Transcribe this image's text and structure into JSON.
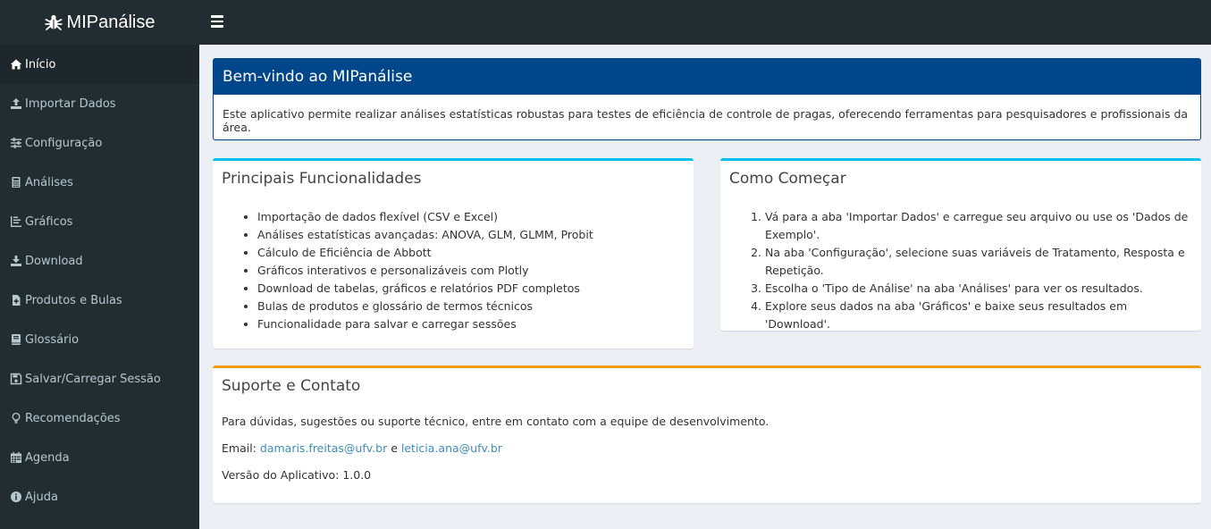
{
  "app": {
    "title": "MIPanálise"
  },
  "sidebar": {
    "items": [
      {
        "label": "Início",
        "icon": "home-icon"
      },
      {
        "label": "Importar Dados",
        "icon": "upload-icon"
      },
      {
        "label": "Configuração",
        "icon": "sliders-icon"
      },
      {
        "label": "Análises",
        "icon": "calculator-icon"
      },
      {
        "label": "Gráficos",
        "icon": "chart-icon"
      },
      {
        "label": "Download",
        "icon": "download-icon"
      },
      {
        "label": "Produtos e Bulas",
        "icon": "file-medical-icon"
      },
      {
        "label": "Glossário",
        "icon": "book-icon"
      },
      {
        "label": "Salvar/Carregar Sessão",
        "icon": "save-icon"
      },
      {
        "label": "Recomendações",
        "icon": "lightbulb-icon"
      },
      {
        "label": "Agenda",
        "icon": "calendar-icon"
      },
      {
        "label": "Ajuda",
        "icon": "info-icon"
      }
    ]
  },
  "welcome": {
    "title": "Bem-vindo ao MIPanálise",
    "text": "Este aplicativo permite realizar análises estatísticas robustas para testes de eficiência de controle de pragas, oferecendo ferramentas para pesquisadores e profissionais da área."
  },
  "features": {
    "title": "Principais Funcionalidades",
    "items": [
      "Importação de dados flexível (CSV e Excel)",
      "Análises estatísticas avançadas: ANOVA, GLM, GLMM, Probit",
      "Cálculo de Eficiência de Abbott",
      "Gráficos interativos e personalizáveis com Plotly",
      "Download de tabelas, gráficos e relatórios PDF completos",
      "Bulas de produtos e glossário de termos técnicos",
      "Funcionalidade para salvar e carregar sessões"
    ]
  },
  "start": {
    "title": "Como Começar",
    "steps": [
      "Vá para a aba 'Importar Dados' e carregue seu arquivo ou use os 'Dados de Exemplo'.",
      "Na aba 'Configuração', selecione suas variáveis de Tratamento, Resposta e Repetição.",
      "Escolha o 'Tipo de Análise' na aba 'Análises' para ver os resultados.",
      "Explore seus dados na aba 'Gráficos' e baixe seus resultados em 'Download'."
    ]
  },
  "support": {
    "title": "Suporte e Contato",
    "text": "Para dúvidas, sugestões ou suporte técnico, entre em contato com a equipe de desenvolvimento.",
    "email_label": "Email:",
    "email1": "damaris.freitas@ufv.br",
    "email_sep": "e",
    "email2": "leticia.ana@ufv.br",
    "version": "Versão do Aplicativo: 1.0.0"
  },
  "colors": {
    "topbar": "#222d32",
    "sidebar": "#222d32",
    "primary_header": "#00468b",
    "info_border": "#00c0ef",
    "warning_border": "#f39c12",
    "link": "#3c8dbc"
  }
}
